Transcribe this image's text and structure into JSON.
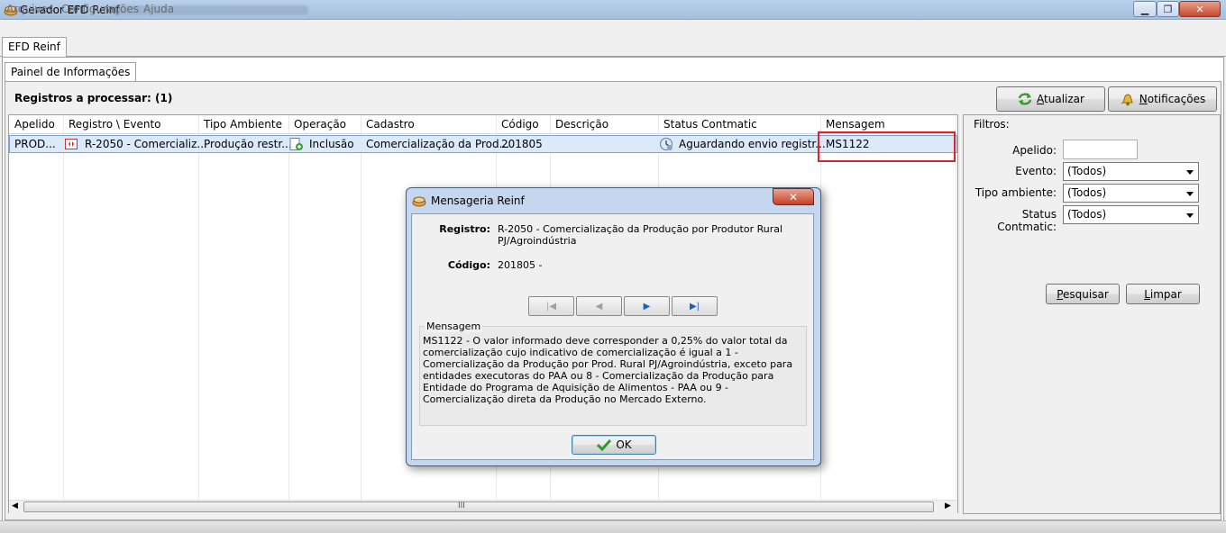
{
  "window": {
    "title": "Gerador EFD Reinf",
    "controls": [
      "minimize-icon",
      "maximize-icon",
      "close-icon"
    ]
  },
  "menu": {
    "items": [
      "Arquivos",
      "Configurações",
      "Ajuda"
    ]
  },
  "outer_tab": {
    "label": "EFD Reinf"
  },
  "inner_tab": {
    "label": "Painel de Informações"
  },
  "toolbar": {
    "registros_label": "Registros a processar: (1)",
    "atualizar_prefix": "",
    "atualizar_key": "A",
    "atualizar_rest": "tualizar",
    "notificacoes_key": "N",
    "notificacoes_rest": "otificações"
  },
  "grid": {
    "columns": [
      "Apelido",
      "Registro \\ Evento",
      "Tipo Ambiente",
      "Operação",
      "Cadastro",
      "Código",
      "Descrição",
      "Status Contmatic",
      "Mensagem"
    ],
    "rows": [
      {
        "apelido": "PROD...",
        "registro": "R-2050 - Comercializ...",
        "tipo_ambiente": "Produção restr...",
        "operacao": "Inclusão",
        "cadastro": "Comercialização da Prod...",
        "codigo": "201805",
        "descricao": "",
        "status": "Aguardando envio registr...",
        "mensagem": "MS1122"
      }
    ],
    "scroll_grip": "III"
  },
  "filters": {
    "title": "Filtros:",
    "apelido_label": "Apelido:",
    "apelido_value": "",
    "evento_label": "Evento:",
    "evento_value": "(Todos)",
    "tipo_label": "Tipo ambiente:",
    "tipo_value": "(Todos)",
    "status_label": "Status Contmatic:",
    "status_value": "(Todos)",
    "pesquisar_key": "P",
    "pesquisar_rest": "esquisar",
    "limpar_key": "L",
    "limpar_rest": "impar"
  },
  "dialog": {
    "title": "Mensageria Reinf",
    "registro_label": "Registro:",
    "registro_line1": "R-2050 - Comercialização da Produção por Produtor Rural",
    "registro_line2": "PJ/Agroindústria",
    "codigo_label": "Código:",
    "codigo_value": "201805 -",
    "message_legend": "Mensagem",
    "message_text": "MS1122 - O valor informado deve corresponder a 0,25% do valor total da comercialização cujo indicativo de comercialização é igual a 1 - Comercialização da Produção por Prod. Rural PJ/Agroindústria, exceto para entidades executoras do PAA ou 8 - Comercialização da Produção para Entidade do Programa de Aquisição de Alimentos - PAA ou 9 - Comercialização direta da Produção no Mercado Externo.",
    "ok_label": "OK"
  },
  "colors": {
    "highlight_box": "#d9262c",
    "selected_row": "#dbe9f8",
    "titlebar": "#b9d1ea"
  }
}
